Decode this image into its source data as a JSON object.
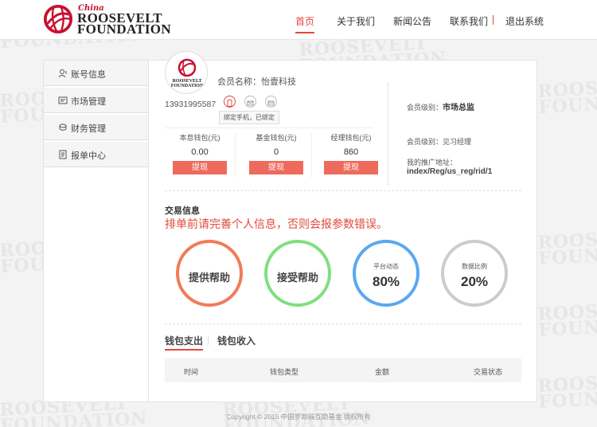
{
  "brand": {
    "line1": "China",
    "line2": "ROOSEVELT",
    "line3": "FOUNDATION",
    "accent_color": "#c8102e"
  },
  "nav": {
    "items": [
      {
        "label": "首页",
        "active": true
      },
      {
        "label": "关于我们",
        "active": false
      },
      {
        "label": "新闻公告",
        "active": false
      },
      {
        "label": "联系我们",
        "active": false
      },
      {
        "label": "退出系统",
        "active": false
      }
    ]
  },
  "sidebar": {
    "items": [
      {
        "label": "账号信息",
        "icon": "user-icon"
      },
      {
        "label": "市场管理",
        "icon": "market-icon"
      },
      {
        "label": "财务管理",
        "icon": "finance-icon"
      },
      {
        "label": "报单中心",
        "icon": "report-icon"
      }
    ]
  },
  "profile": {
    "member_label": "会员名称：",
    "member_name": "怡壹科技",
    "phone": "13931995587",
    "bind_tooltip": "绑定手机，已绑定"
  },
  "wallets": [
    {
      "label": "本息钱包(元)",
      "value": "0.00",
      "button": "提现"
    },
    {
      "label": "基金钱包(元)",
      "value": "0",
      "button": "提现"
    },
    {
      "label": "经理钱包(元)",
      "value": "860",
      "button": "提现"
    }
  ],
  "levels": {
    "member_level_label": "会员级别：",
    "member_level_value": "市场总监",
    "manager_level_label": "会员级别：",
    "manager_level_value": "见习经理",
    "promo_label": "我的推广地址：",
    "promo_url": "index/Reg/us_reg/rid/1"
  },
  "trade": {
    "title": "交易信息",
    "warning": "排单前请完善个人信息，否则会报参数错误。",
    "rings": [
      {
        "label": "提供帮助",
        "color": "#f07b5a"
      },
      {
        "label": "接受帮助",
        "color": "#7ee07e"
      },
      {
        "small": "平台动态",
        "pct": "80%",
        "color": "#5aa8f0"
      },
      {
        "small": "数据比例",
        "pct": "20%",
        "color": "#cccccc"
      }
    ]
  },
  "tabs": [
    {
      "label": "钱包支出",
      "active": true
    },
    {
      "label": "钱包收入",
      "active": false
    }
  ],
  "table": {
    "columns": [
      "时间",
      "钱包类型",
      "金额",
      "交易状态"
    ]
  },
  "footer": {
    "text": "Copyright © 2015 中国罗斯福互助基金 版权所有"
  }
}
